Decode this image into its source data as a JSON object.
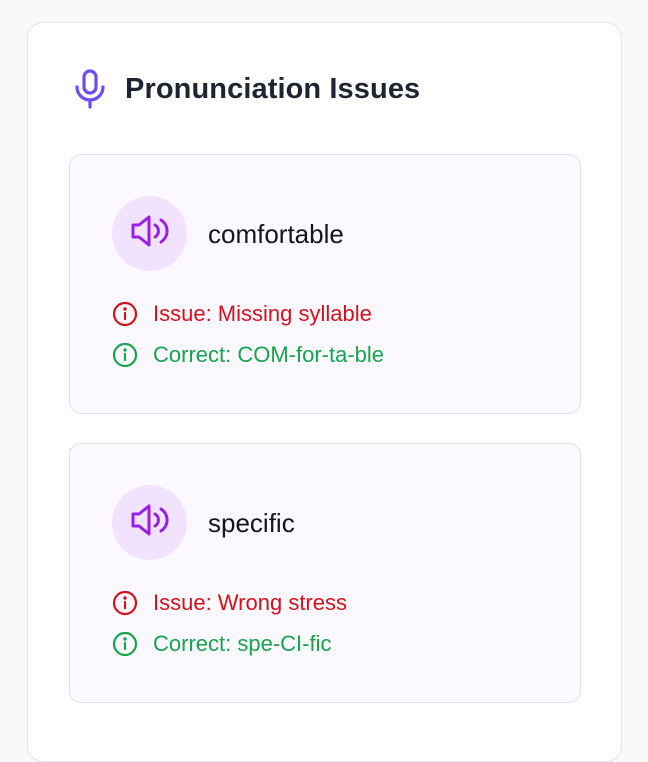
{
  "panel": {
    "title": "Pronunciation Issues",
    "title_icon": "microphone-icon",
    "accent_color": "#6d4df2"
  },
  "items": [
    {
      "word": "comfortable",
      "icon": "speaker-icon",
      "issue_text": "Issue: Missing syllable",
      "correct_text": "Correct: COM-for-ta-ble"
    },
    {
      "word": "specific",
      "icon": "speaker-icon",
      "issue_text": "Issue: Wrong stress",
      "correct_text": "Correct: spe-CI-fic"
    }
  ],
  "colors": {
    "issue": "#d3121c",
    "correct": "#17a44d",
    "speaker": "#9b1ee6",
    "card_bg": "#fcf8ff",
    "avatar_bg": "#f1e3fd"
  }
}
